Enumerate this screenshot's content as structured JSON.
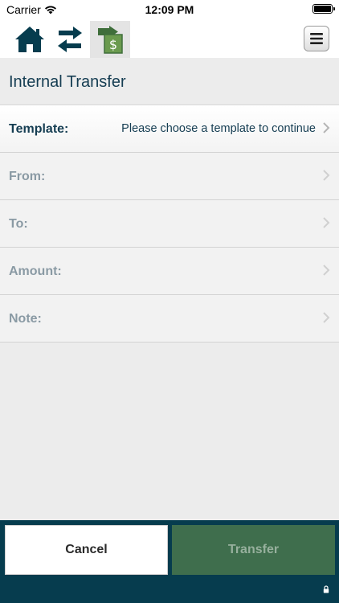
{
  "status_bar": {
    "carrier": "Carrier",
    "time": "12:09 PM"
  },
  "nav": {
    "icons": [
      "home-icon",
      "transfers-icon",
      "internal-transfer-icon",
      "menu-icon"
    ],
    "active_color": "#3f6e3b",
    "icon_color": "#063c4e"
  },
  "page": {
    "title": "Internal Transfer"
  },
  "form": {
    "template": {
      "label": "Template:",
      "value": "Please choose a template to continue"
    },
    "from": {
      "label": "From:"
    },
    "to": {
      "label": "To:"
    },
    "amount": {
      "label": "Amount:"
    },
    "note": {
      "label": "Note:"
    }
  },
  "actions": {
    "cancel_label": "Cancel",
    "transfer_label": "Transfer"
  },
  "colors": {
    "brand_dark": "#063c4e",
    "brand_green": "#3f6e4d",
    "label_active": "#153d52",
    "label_inactive": "#8a9aa4"
  }
}
